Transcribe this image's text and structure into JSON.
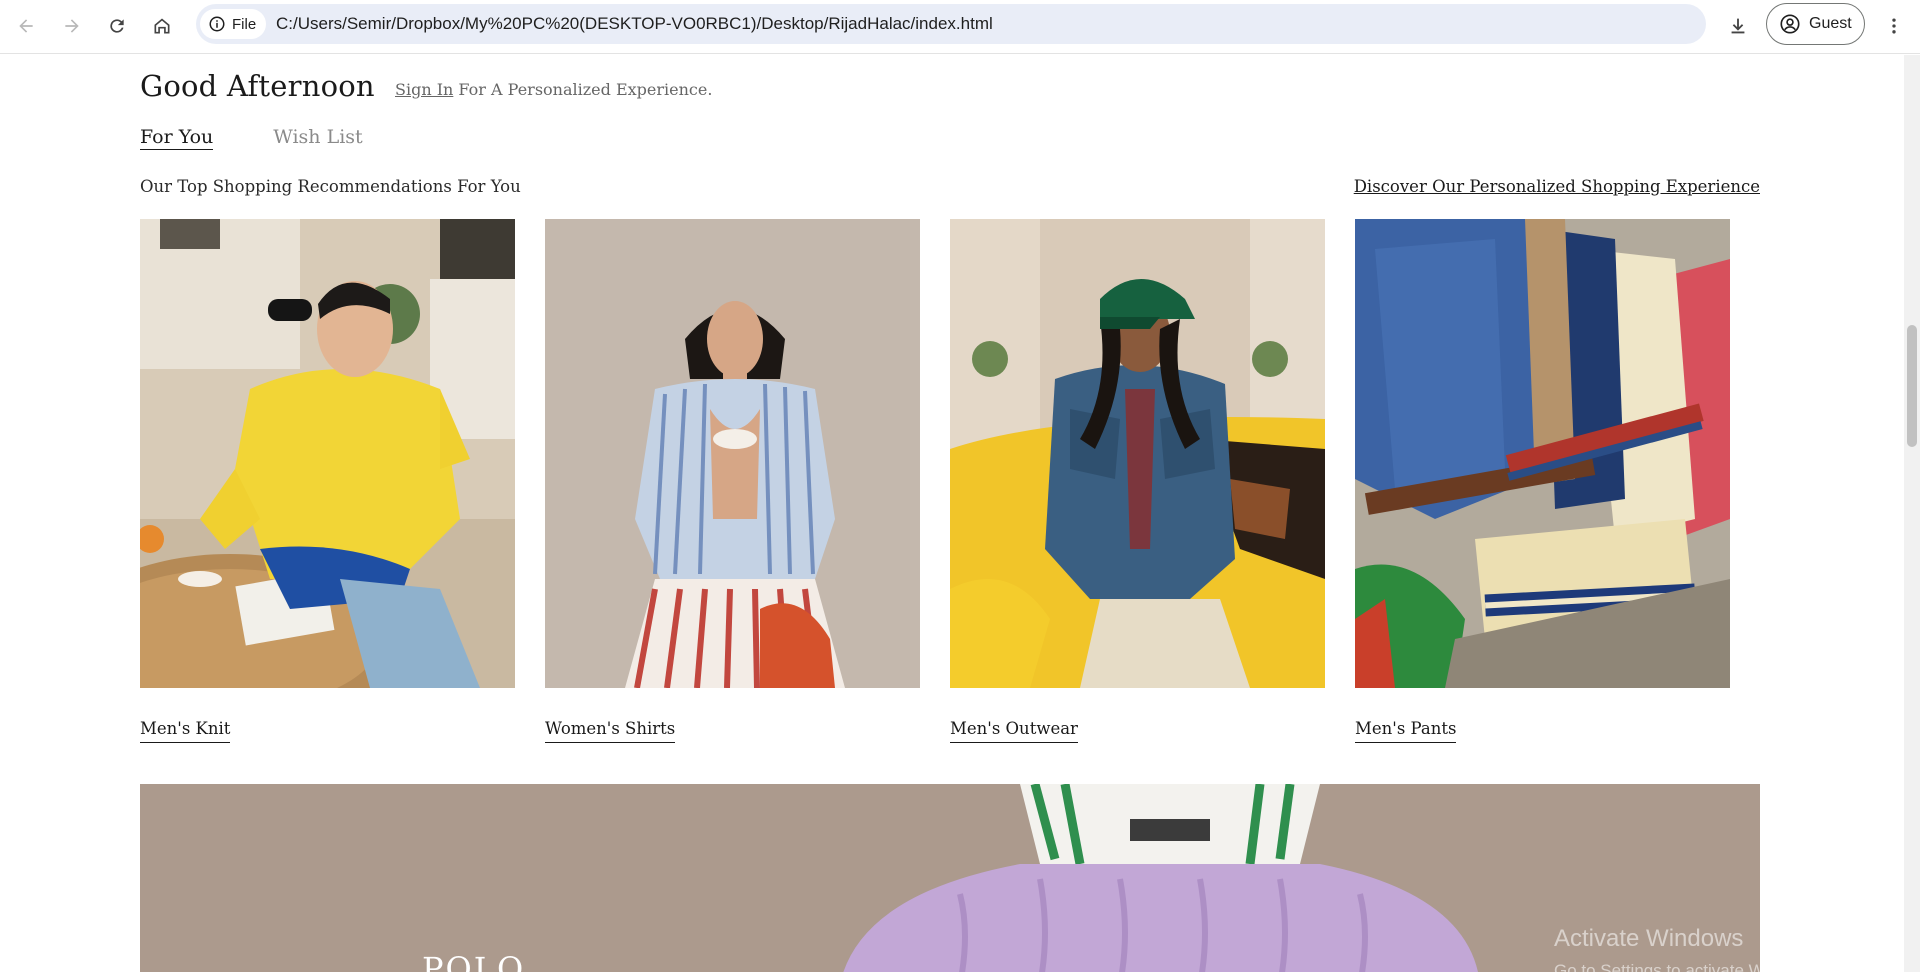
{
  "browser": {
    "site_chip_label": "File",
    "url": "C:/Users/Semir/Dropbox/My%20PC%20(DESKTOP-VO0RBC1)/Desktop/RijadHalac/index.html",
    "profile_label": "Guest",
    "icons": {
      "back": "back-arrow-icon",
      "forward": "forward-arrow-icon",
      "reload": "reload-icon",
      "home": "home-icon",
      "info": "info-icon",
      "download": "download-icon",
      "profile": "account-circle-icon",
      "menu": "kebab-menu-icon"
    }
  },
  "header": {
    "greeting": "Good Afternoon",
    "sign_in_link": "Sign In",
    "sign_in_suffix": " For A Personalized Experience."
  },
  "tabs": [
    {
      "label": "For You",
      "active": true
    },
    {
      "label": "Wish List",
      "active": false
    }
  ],
  "recommendations": {
    "heading": "Our Top Shopping Recommendations For You",
    "discover_link": "Discover Our Personalized Shopping Experience",
    "items": [
      {
        "label": "Men's Knit"
      },
      {
        "label": "Women's Shirts"
      },
      {
        "label": "Men's Outwear"
      },
      {
        "label": "Men's Pants"
      }
    ]
  },
  "hero": {
    "title": "POLO"
  },
  "os_watermark": {
    "title": "Activate Windows",
    "subtitle": "Go to Settings to activate Windows."
  },
  "colors": {
    "omnibox_bg": "#e9edf7",
    "text_primary": "#1a1a1a",
    "text_muted": "#666666"
  }
}
